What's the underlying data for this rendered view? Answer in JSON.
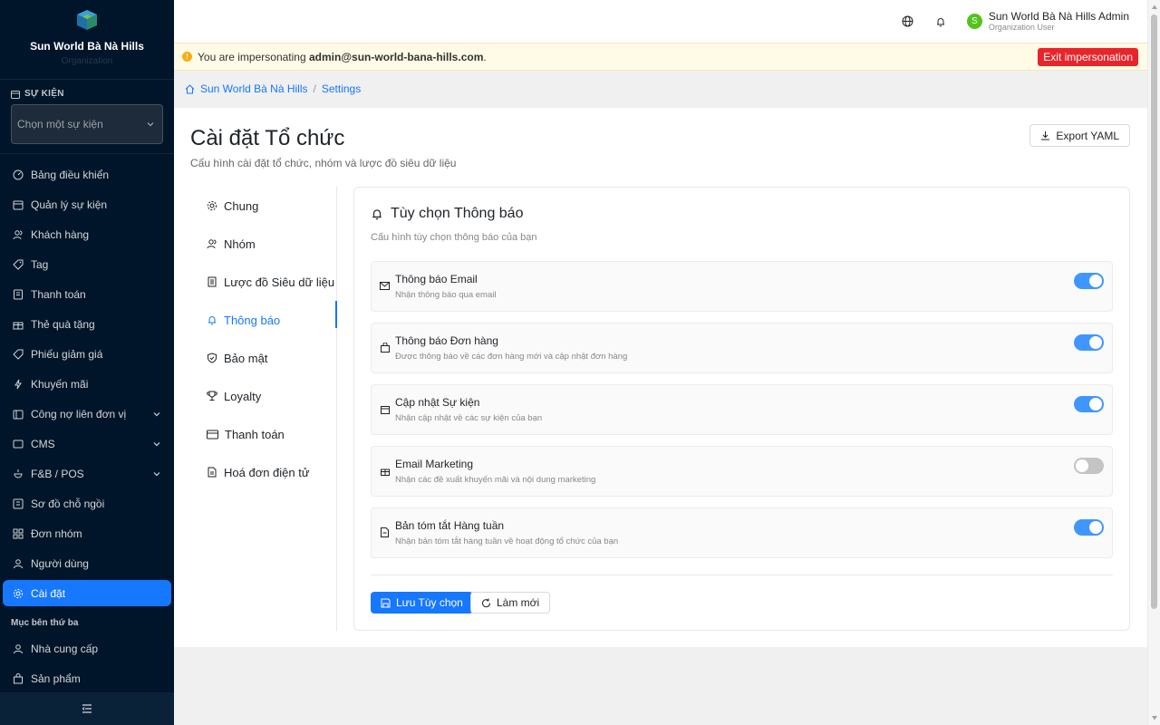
{
  "sidebar": {
    "brand": {
      "name": "Sun World Bà Nà Hills",
      "sub": "Organization"
    },
    "event": {
      "heading": "SỰ KIỆN",
      "placeholder": "Chọn một sự kiện"
    },
    "items": [
      {
        "label": "Bảng điều khiển",
        "icon": "dashboard-icon"
      },
      {
        "label": "Quản lý sự kiện",
        "icon": "calendar-icon"
      },
      {
        "label": "Khách hàng",
        "icon": "users-icon"
      },
      {
        "label": "Tag",
        "icon": "tag-icon"
      },
      {
        "label": "Thanh toán",
        "icon": "receipt-icon"
      },
      {
        "label": "Thẻ quà tặng",
        "icon": "gift-icon"
      },
      {
        "label": "Phiếu giảm giá",
        "icon": "coupon-icon"
      },
      {
        "label": "Khuyến mãi",
        "icon": "flash-icon"
      },
      {
        "label": "Công nợ liên đơn vị",
        "icon": "ledger-icon"
      },
      {
        "label": "CMS",
        "icon": "cms-icon"
      },
      {
        "label": "F&B / POS",
        "icon": "food-icon"
      },
      {
        "label": "Sơ đồ chỗ ngồi",
        "icon": "seat-map-icon"
      },
      {
        "label": "Đơn nhóm",
        "icon": "group-order-icon"
      },
      {
        "label": "Người dùng",
        "icon": "user-icon"
      },
      {
        "label": "Cài đặt",
        "icon": "gear-icon"
      }
    ],
    "group_label": "Mục bên thứ ba",
    "third_party": [
      {
        "label": "Nhà cung cấp",
        "icon": "user-icon"
      },
      {
        "label": "Sản phẩm",
        "icon": "shopping-bag-icon"
      }
    ]
  },
  "topbar": {
    "user_name": "Sun World Bà Nà Hills Admin",
    "user_role": "Organization User",
    "avatar_letter": "S"
  },
  "impersonation": {
    "prefix": "You are impersonating ",
    "email": "admin@sun-world-bana-hills.com",
    "suffix": ".",
    "exit_label": "Exit impersonation"
  },
  "breadcrumb": {
    "home": "Sun World Bà Nà Hills",
    "sep": "/",
    "current": "Settings"
  },
  "page": {
    "title": "Cài đặt Tổ chức",
    "subtitle": "Cấu hình cài đặt tổ chức, nhóm và lược đồ siêu dữ liệu",
    "export_label": "Export YAML"
  },
  "settings_nav": [
    {
      "label": "Chung",
      "icon": "gear-icon"
    },
    {
      "label": "Nhóm",
      "icon": "team-icon"
    },
    {
      "label": "Lược đồ Siêu dữ liệu",
      "icon": "schema-icon"
    },
    {
      "label": "Thông báo",
      "icon": "bell-icon"
    },
    {
      "label": "Bảo mật",
      "icon": "shield-icon"
    },
    {
      "label": "Loyalty",
      "icon": "trophy-icon"
    },
    {
      "label": "Thanh toán",
      "icon": "credit-card-icon"
    },
    {
      "label": "Hoá đơn điện tử",
      "icon": "invoice-icon"
    }
  ],
  "notifications": {
    "title": "Tùy chọn Thông báo",
    "subtitle": "Cấu hình tùy chọn thông báo của bạn",
    "options": [
      {
        "title": "Thông báo Email",
        "desc": "Nhận thông báo qua email",
        "enabled": true,
        "icon": "mail-icon"
      },
      {
        "title": "Thông báo Đơn hàng",
        "desc": "Được thông báo về các đơn hàng mới và cập nhật đơn hàng",
        "enabled": true,
        "icon": "shopping-bag-icon"
      },
      {
        "title": "Cập nhật Sự kiện",
        "desc": "Nhận cập nhật về các sự kiện của bạn",
        "enabled": true,
        "icon": "calendar-icon"
      },
      {
        "title": "Email Marketing",
        "desc": "Nhận các đề xuất khuyến mãi và nội dung marketing",
        "enabled": false,
        "icon": "gift-icon"
      },
      {
        "title": "Bản tóm tắt Hàng tuần",
        "desc": "Nhận bản tóm tắt hàng tuần về hoạt động tổ chức của bạn",
        "enabled": true,
        "icon": "document-icon"
      }
    ],
    "save_label": "Lưu Tùy chọn",
    "reset_label": "Làm mới"
  },
  "colors": {
    "sidebar_bg": "#001529",
    "accent": "#1677ff",
    "danger": "#e8252a",
    "banner_bg": "#fffbe6"
  }
}
